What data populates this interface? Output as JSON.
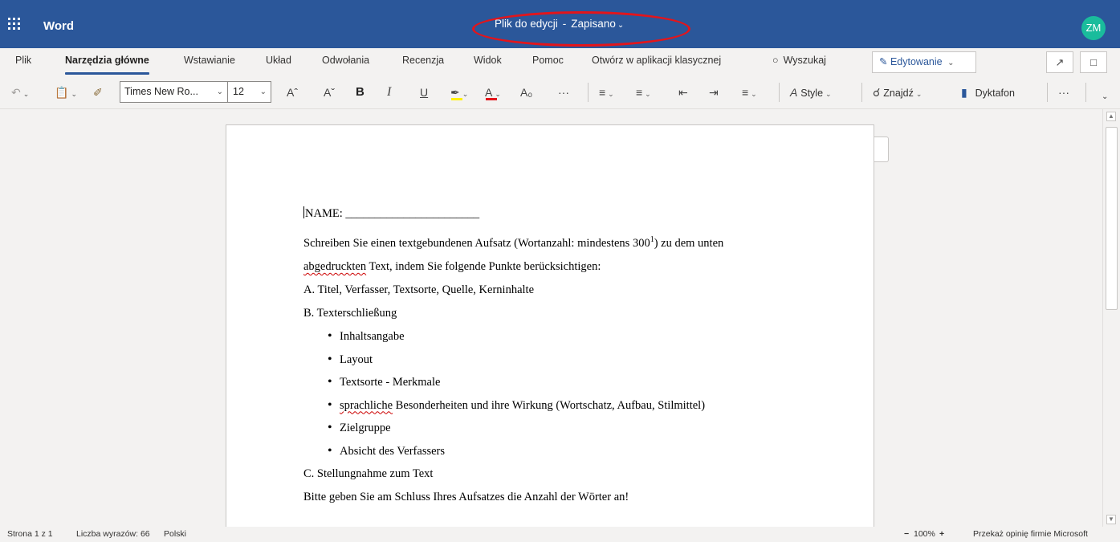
{
  "app": {
    "name": "Word",
    "document_title": "Plik do edycji",
    "title_separator": "-",
    "save_status": "Zapisano",
    "user_initials": "ZM",
    "icons": {
      "launcher": "waffle-icon",
      "chevron": "chevron-down-icon"
    }
  },
  "tabs": [
    {
      "label": "Plik"
    },
    {
      "label": "Narzędzia główne",
      "active": true
    },
    {
      "label": "Wstawianie"
    },
    {
      "label": "Układ"
    },
    {
      "label": "Odwołania"
    },
    {
      "label": "Recenzja"
    },
    {
      "label": "Widok"
    },
    {
      "label": "Pomoc"
    },
    {
      "label": "Otwórz w aplikacji klasycznej"
    },
    {
      "label": "Wyszukaj",
      "icon": "lightbulb-icon"
    }
  ],
  "mode_button": {
    "label": "Edytowanie",
    "icon": "pencil-icon"
  },
  "ribbon": {
    "font_name": "Times New Ro...",
    "font_size": "12",
    "styles_label": "Style",
    "find_label": "Znajdź",
    "dictate_label": "Dyktafon",
    "bold_glyph": "B",
    "italic_glyph": "I",
    "underline_glyph": "U",
    "grow_glyph": "Aˆ",
    "shrink_glyph": "Aˇ",
    "more_glyph": "···",
    "font_color_glyph": "A",
    "highlight_color": "#fff100",
    "font_color": "#e3151b"
  },
  "document": {
    "name_line": "NAME: _______________________",
    "intro_1_before": "Schreiben Sie einen textgebundenen Aufsatz (Wortanzahl: mindestens 300",
    "intro_1_sup": "1",
    "intro_1_after": ") zu dem unten",
    "intro_2_sq": "abgedruckten",
    "intro_2_rest": " Text, indem Sie folgende Punkte berücksichtigen:",
    "section_a": "A. Titel, Verfasser, Textsorte, Quelle, Kerninhalte",
    "section_b": "B. Texterschließung",
    "bullets": [
      {
        "text": "Inhaltsangabe"
      },
      {
        "text": "Layout"
      },
      {
        "text": "Textsorte - Merkmale"
      },
      {
        "sq": "sprachliche",
        "text": " Besonderheiten und ihre Wirkung (Wortschatz, Aufbau, Stilmittel)"
      },
      {
        "text": "Zielgruppe"
      },
      {
        "text": "Absicht des Verfassers"
      }
    ],
    "section_c": "C. Stellungnahme zum Text",
    "closing": "Bitte geben Sie am Schluss Ihres Aufsatzes die Anzahl der Wörter an!"
  },
  "statusbar": {
    "page": "Strona 1 z 1",
    "words": "Liczba wyrazów: 66",
    "language": "Polski",
    "zoom_minus": "−",
    "zoom": "100%",
    "zoom_plus": "+",
    "feedback": "Przekaż opinię firmie Microsoft"
  }
}
